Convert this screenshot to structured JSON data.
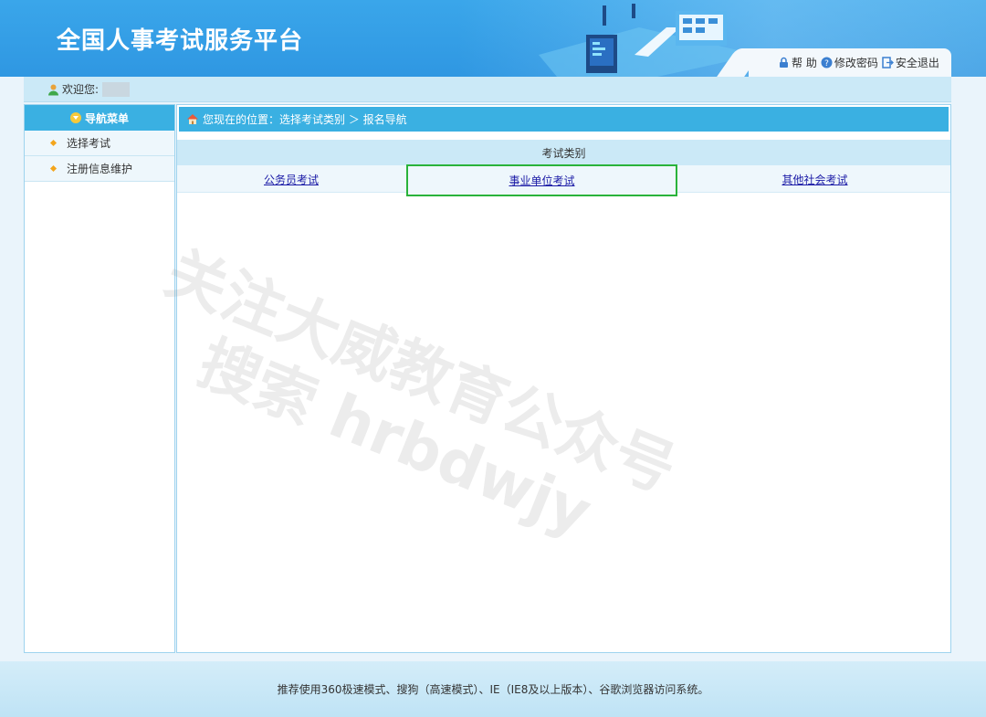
{
  "header": {
    "site_title": "全国人事考试服务平台",
    "tools": [
      {
        "label": "帮 助",
        "icon": "lock-icon"
      },
      {
        "label": "修改密码",
        "icon": "question-icon"
      },
      {
        "label": "安全退出",
        "icon": "exit-icon"
      }
    ]
  },
  "welcome": {
    "label": "欢迎您:",
    "icon": "user-icon"
  },
  "sidebar": {
    "title": "导航菜单",
    "items": [
      {
        "label": "选择考试"
      },
      {
        "label": "注册信息维护"
      }
    ]
  },
  "breadcrumb": {
    "text": "您现在的位置：选择考试类别 ＞ 报名导航"
  },
  "exam_categories": {
    "header": "考试类别",
    "items": [
      {
        "label": "公务员考试",
        "selected": false
      },
      {
        "label": "事业单位考试",
        "selected": true
      },
      {
        "label": "其他社会考试",
        "selected": false
      }
    ]
  },
  "watermark": {
    "line1": "关注大威教育公众号",
    "line2": "搜索 hrbdwjy"
  },
  "footer": {
    "text": "推荐使用360极速模式、搜狗（高速模式）、IE（IE8及以上版本）、谷歌浏览器访问系统。"
  },
  "colors": {
    "header_blue": "#2f97e2",
    "bar_blue": "#3ab0e2",
    "highlight_green": "#29b33a",
    "link": "#1a1aa6"
  }
}
